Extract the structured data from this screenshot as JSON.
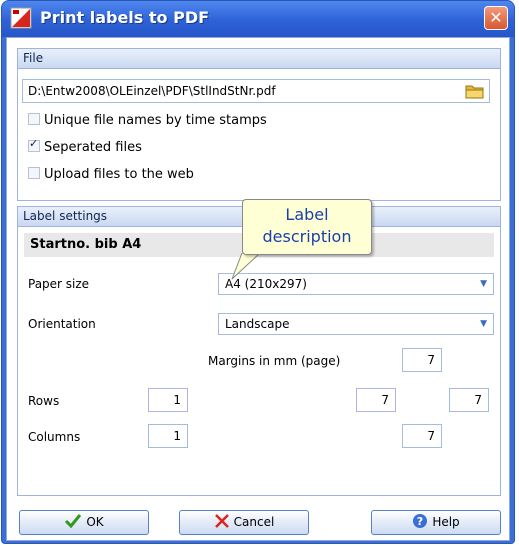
{
  "window": {
    "title": "Print labels to PDF",
    "close_glyph": "✕"
  },
  "file_section": {
    "header": "File",
    "path": "D:\\Entw2008\\OLEinzel\\PDF\\StlIndStNr.pdf",
    "checkboxes": [
      {
        "label": "Unique file names by time stamps",
        "checked": false
      },
      {
        "label": "Seperated files",
        "checked": true
      },
      {
        "label": "Upload files to the web",
        "checked": false
      }
    ]
  },
  "label_section": {
    "header": "Label settings",
    "description": "Startno. bib A4",
    "paper_size_label": "Paper size",
    "paper_size_value": "A4 (210x297)",
    "orientation_label": "Orientation",
    "orientation_value": "Landscape",
    "margins_label": "Margins in mm (page)",
    "margin_top": "7",
    "margin_left": "7",
    "margin_right": "7",
    "margin_bottom": "7",
    "rows_label": "Rows",
    "rows_value": "1",
    "columns_label": "Columns",
    "columns_value": "1"
  },
  "callout": {
    "line1": "Label",
    "line2": "description"
  },
  "buttons": {
    "ok": "OK",
    "cancel": "Cancel",
    "help": "Help"
  },
  "icons": {
    "ok": "check-icon",
    "cancel": "x-icon",
    "help": "help-icon",
    "folder": "folder-icon",
    "app": "app-icon"
  }
}
